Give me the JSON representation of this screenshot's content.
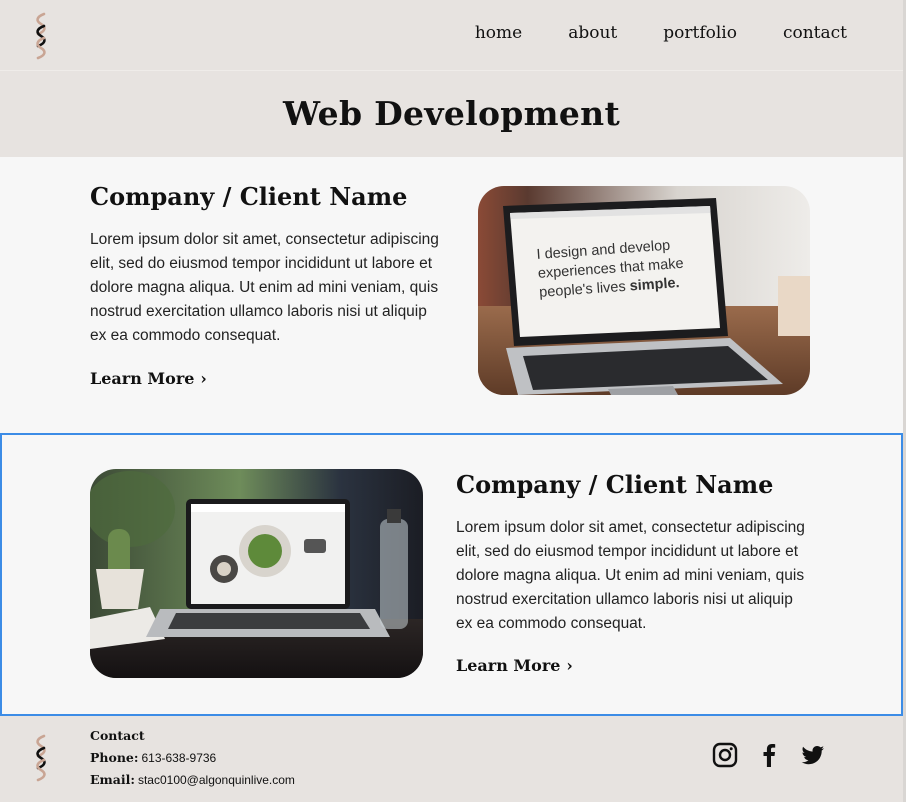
{
  "nav": {
    "items": [
      "home",
      "about",
      "portfolio",
      "contact"
    ]
  },
  "page": {
    "title": "Web Development"
  },
  "projects": [
    {
      "heading": "Company / Client Name",
      "description": "Lorem ipsum dolor sit amet, consectetur adipiscing elit, sed do eiusmod tempor incididunt ut labore et dolore magna aliqua. Ut enim ad mini veniam, quis nostrud exercitation ullamco laboris nisi ut  aliquip ex ea commodo consequat.",
      "link": "Learn More",
      "screen_text": [
        "I design and develop",
        "experiences that make",
        "people's lives",
        "simple."
      ]
    },
    {
      "heading": "Company / Client Name",
      "description": "Lorem ipsum dolor sit amet, consectetur adipiscing elit, sed do eiusmod tempor incididunt ut labore et dolore magna aliqua. Ut enim ad mini veniam, quis nostrud exercitation ullamco laboris nisi ut  aliquip ex ea commodo consequat.",
      "link": "Learn More"
    }
  ],
  "footer": {
    "heading": "Contact",
    "phone_label": "Phone:",
    "phone": "613-638-9736",
    "email_label": "Email:",
    "email": "stac0100@algonquinlive.com",
    "socials": [
      "instagram-icon",
      "facebook-icon",
      "twitter-icon"
    ]
  },
  "colors": {
    "header_bg": "#e7e3e0",
    "section_bg": "#f7f7f7",
    "logo_tan": "#c9a594",
    "selection": "#3c8ce6"
  }
}
